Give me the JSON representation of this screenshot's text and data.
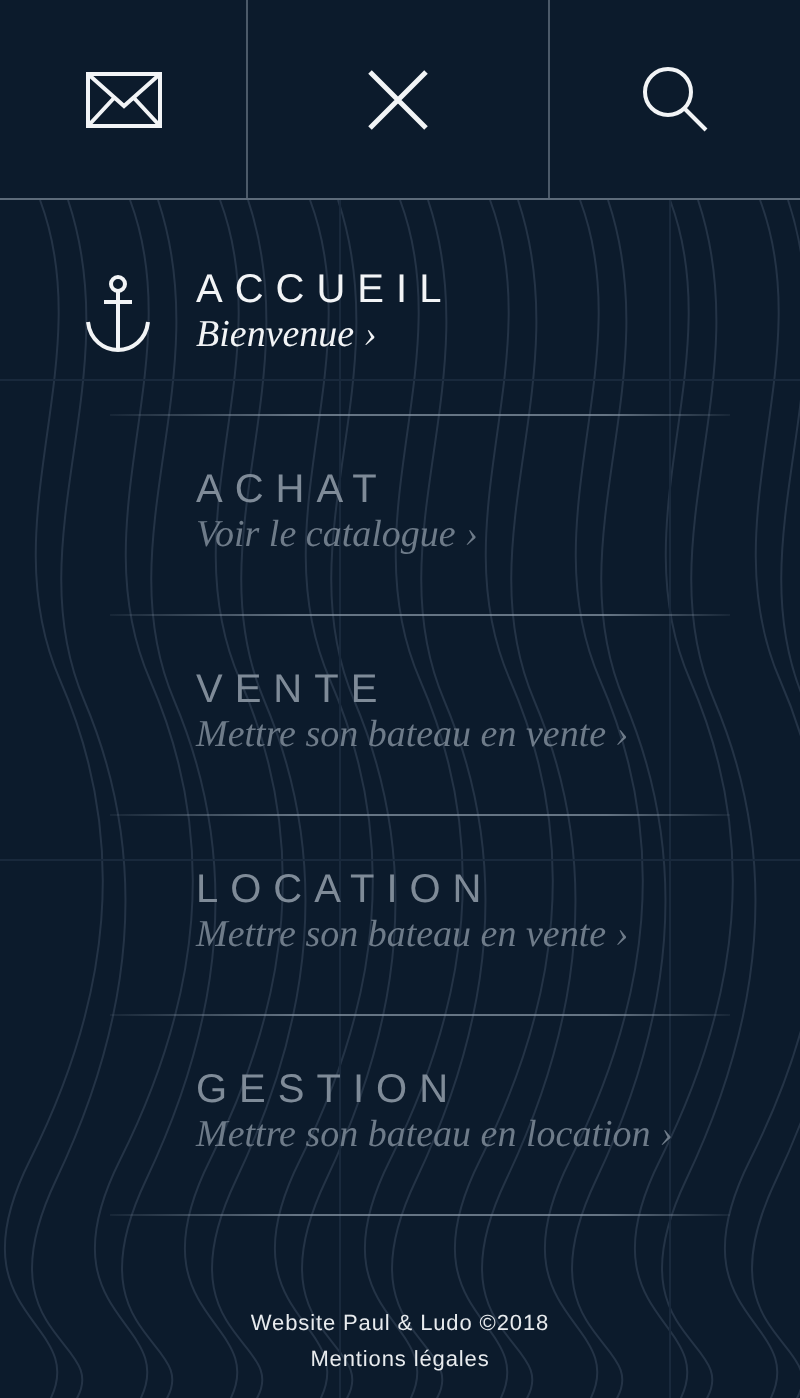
{
  "header": {
    "buttons": [
      {
        "kind": "mail"
      },
      {
        "kind": "close"
      },
      {
        "kind": "search"
      }
    ]
  },
  "menu": [
    {
      "title": "ACCUEIL",
      "subtitle": "Bienvenue ›",
      "selected": true
    },
    {
      "title": "ACHAT",
      "subtitle": "Voir le catalogue ›",
      "selected": false
    },
    {
      "title": "VENTE",
      "subtitle": "Mettre son bateau en vente ›",
      "selected": false
    },
    {
      "title": "LOCATION",
      "subtitle": "Mettre son bateau en vente ›",
      "selected": false
    },
    {
      "title": "GESTION",
      "subtitle": "Mettre son bateau en location ›",
      "selected": false
    }
  ],
  "footer": {
    "copyright": "Website Paul & Ludo ©2018",
    "link": "Mentions légales"
  }
}
